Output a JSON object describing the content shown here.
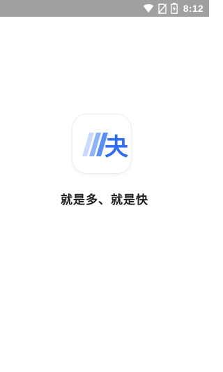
{
  "status_bar": {
    "time": "8:12",
    "icons": [
      "wifi-icon",
      "no-sim-icon",
      "battery-icon"
    ],
    "background": "#a0a0a0"
  },
  "app": {
    "logo_char": "夬",
    "logo_icon": "app-logo-icon",
    "slogan": "就是多、就是快",
    "accent": "#2f6df6"
  }
}
